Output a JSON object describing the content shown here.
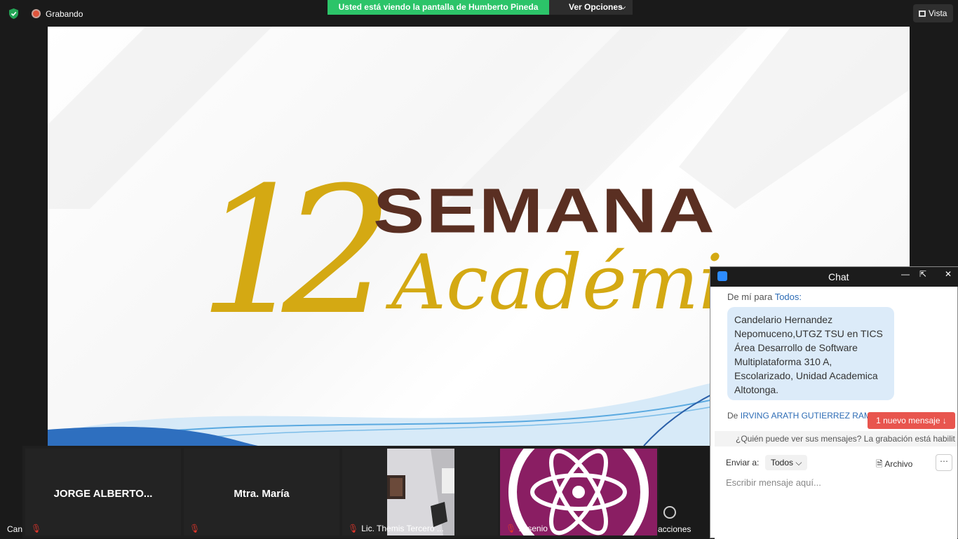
{
  "topbar": {
    "recording_label": "Grabando",
    "viewing_banner": "Usted está viendo la pantalla de Humberto Pineda",
    "view_options_label": "Ver Opciones",
    "view_label": "Vista"
  },
  "shared_screen": {
    "number": "12",
    "word1": "SEMANA",
    "word2": "Académica"
  },
  "gallery": {
    "tiles": [
      {
        "name": "JORGE ALBERTO...",
        "muted": true
      },
      {
        "name": "Mtra. María",
        "muted": true
      },
      {
        "name": "Lic. Themis Tercero ...",
        "muted": true
      },
      {
        "name": "Arsenio",
        "muted": true
      }
    ],
    "left_cut_label": "Can",
    "reactions_label": "acciones"
  },
  "chat": {
    "title": "Chat",
    "msg1_from_prefix": "De mí para",
    "msg1_to": "Todos:",
    "msg1_text": "Candelario Hernandez Nepomuceno,UTGZ TSU en TICS Área Desarrollo de Software Multiplataforma 310 A, Escolarizado, Unidad Academica Altotonga.",
    "msg2_from_prefix": "De",
    "msg2_from": "IRVING ARATH GUTIERREZ RAM",
    "new_message_label": "1 nuevo mensaje",
    "notice": "¿Quién puede ver sus mensajes? La grabación está habilit",
    "send_to_label": "Enviar a:",
    "send_to_value": "Todos",
    "file_label": "Archivo",
    "input_placeholder": "Escribir mensaje aquí..."
  },
  "colors": {
    "banner_green": "#2cc469",
    "gold": "#d4a913",
    "brown": "#5a2f22",
    "new_msg_red": "#e8554e"
  }
}
